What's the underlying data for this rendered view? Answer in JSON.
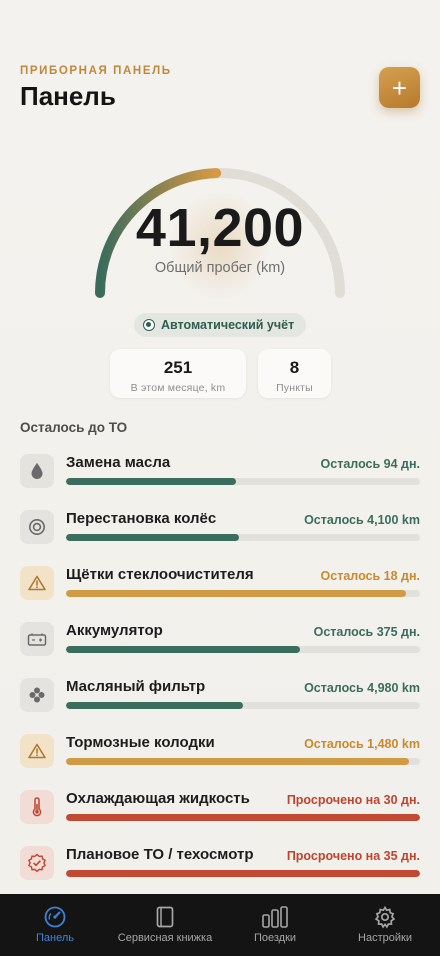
{
  "header": {
    "overline": "ПРИБОРНАЯ ПАНЕЛЬ",
    "title": "Панель",
    "add_label": "+"
  },
  "odometer": {
    "value": "41,200",
    "label": "Общий пробег (km)",
    "gauge_progress": 0.49,
    "colors": {
      "start": "#3b6b5c",
      "end": "#d79a44",
      "track": "#e0ddd6"
    }
  },
  "auto_tracking": {
    "label": "Автоматический учёт"
  },
  "stats": [
    {
      "value": "251",
      "label": "В этом месяце, km"
    },
    {
      "value": "8",
      "label": "Пункты"
    }
  ],
  "section_title": "Осталось до ТО",
  "items": [
    {
      "name": "Замена масла",
      "status": "Осталось 94 дн.",
      "level": "ok",
      "progress": 0.48,
      "icon": "drop-icon"
    },
    {
      "name": "Перестановка колёс",
      "status": "Осталось 4,100 km",
      "level": "ok",
      "progress": 0.49,
      "icon": "tire-icon"
    },
    {
      "name": "Щётки стеклоочистителя",
      "status": "Осталось 18 дн.",
      "level": "warn",
      "progress": 0.96,
      "icon": "warning-icon"
    },
    {
      "name": "Аккумулятор",
      "status": "Осталось 375 дн.",
      "level": "ok",
      "progress": 0.66,
      "icon": "battery-icon"
    },
    {
      "name": "Масляный фильтр",
      "status": "Осталось 4,980 km",
      "level": "ok",
      "progress": 0.5,
      "icon": "filter-icon"
    },
    {
      "name": "Тормозные колодки",
      "status": "Осталось 1,480 km",
      "level": "warn",
      "progress": 0.97,
      "icon": "warning-icon"
    },
    {
      "name": "Охлаждающая жидкость",
      "status": "Просрочено на 30 дн.",
      "level": "over",
      "progress": 1.0,
      "icon": "thermometer-icon"
    },
    {
      "name": "Плановое ТО / техосмотр",
      "status": "Просрочено на 35 дн.",
      "level": "over",
      "progress": 1.0,
      "icon": "badge-check-icon"
    }
  ],
  "tabs": [
    {
      "label": "Панель",
      "icon": "gauge-icon",
      "active": true
    },
    {
      "label": "Сервисная книжка",
      "icon": "book-icon",
      "active": false
    },
    {
      "label": "Поездки",
      "icon": "bars-icon",
      "active": false
    },
    {
      "label": "Настройки",
      "icon": "gear-icon",
      "active": false
    }
  ]
}
